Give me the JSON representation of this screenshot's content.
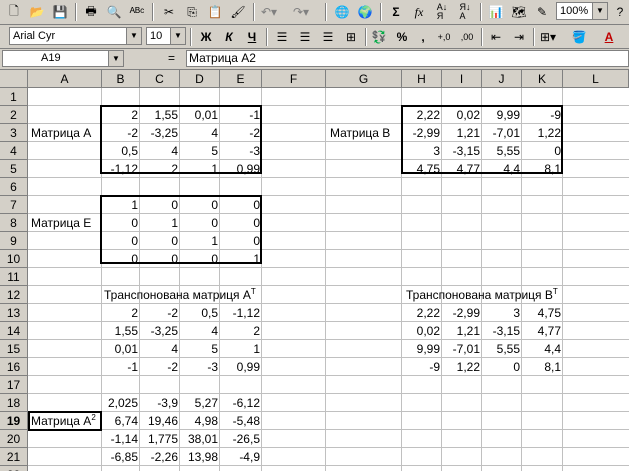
{
  "toolbar": {
    "zoom": "100%",
    "font": "Arial Cyr",
    "size": "10",
    "bold_label": "Ж",
    "italic_label": "К",
    "underline_label": "Ч",
    "sum_label": "Σ",
    "fx_label": "fx",
    "percent_label": "%",
    "comma_label": ",",
    "inc_dec_label": "+,0",
    "dec_dec_label": ",00",
    "font_color_label": "A"
  },
  "formula_bar": {
    "name_box": "A19",
    "equals": "=",
    "content": "Матрица А2"
  },
  "columns": [
    "A",
    "B",
    "C",
    "D",
    "E",
    "F",
    "G",
    "H",
    "I",
    "J",
    "K",
    "L"
  ],
  "rows": [
    "1",
    "2",
    "3",
    "4",
    "5",
    "6",
    "7",
    "8",
    "9",
    "10",
    "11",
    "12",
    "13",
    "14",
    "15",
    "16",
    "17",
    "18",
    "19",
    "20",
    "21",
    "22"
  ],
  "selected_row": 19,
  "labels": {
    "matrix_a": "Матрица А",
    "matrix_b": "Матрица В",
    "matrix_e": "Матрица Е",
    "transposed_a": "Транспонована матриця А",
    "transposed_a_sup": "T",
    "transposed_b": "Транспонована матриця В",
    "transposed_b_sup": "T",
    "matrix_a2": "Матрица А",
    "matrix_a2_sup": "2"
  },
  "matrix_a": [
    [
      "2",
      "1,55",
      "0,01",
      "-1"
    ],
    [
      "-2",
      "-3,25",
      "4",
      "-2"
    ],
    [
      "0,5",
      "4",
      "5",
      "-3"
    ],
    [
      "-1,12",
      "2",
      "1",
      "0,99"
    ]
  ],
  "matrix_b": [
    [
      "2,22",
      "0,02",
      "9,99",
      "-9"
    ],
    [
      "-2,99",
      "1,21",
      "-7,01",
      "1,22"
    ],
    [
      "3",
      "-3,15",
      "5,55",
      "0"
    ],
    [
      "4,75",
      "4,77",
      "4,4",
      "8,1"
    ]
  ],
  "matrix_e": [
    [
      "1",
      "0",
      "0",
      "0"
    ],
    [
      "0",
      "1",
      "0",
      "0"
    ],
    [
      "0",
      "0",
      "1",
      "0"
    ],
    [
      "0",
      "0",
      "0",
      "1"
    ]
  ],
  "transposed_a_values": [
    [
      "2",
      "-2",
      "0,5",
      "-1,12"
    ],
    [
      "1,55",
      "-3,25",
      "4",
      "2"
    ],
    [
      "0,01",
      "4",
      "5",
      "1"
    ],
    [
      "-1",
      "-2",
      "-3",
      "0,99"
    ]
  ],
  "transposed_b_values": [
    [
      "2,22",
      "-2,99",
      "3",
      "4,75"
    ],
    [
      "0,02",
      "1,21",
      "-3,15",
      "4,77"
    ],
    [
      "9,99",
      "-7,01",
      "5,55",
      "4,4"
    ],
    [
      "-9",
      "1,22",
      "0",
      "8,1"
    ]
  ],
  "matrix_a2_values": [
    [
      "2,025",
      "-3,9",
      "5,27",
      "-6,12"
    ],
    [
      "6,74",
      "19,46",
      "4,98",
      "-5,48"
    ],
    [
      "-1,14",
      "1,775",
      "38,01",
      "-26,5"
    ],
    [
      "-6,85",
      "-2,26",
      "13,98",
      "-4,9"
    ]
  ]
}
